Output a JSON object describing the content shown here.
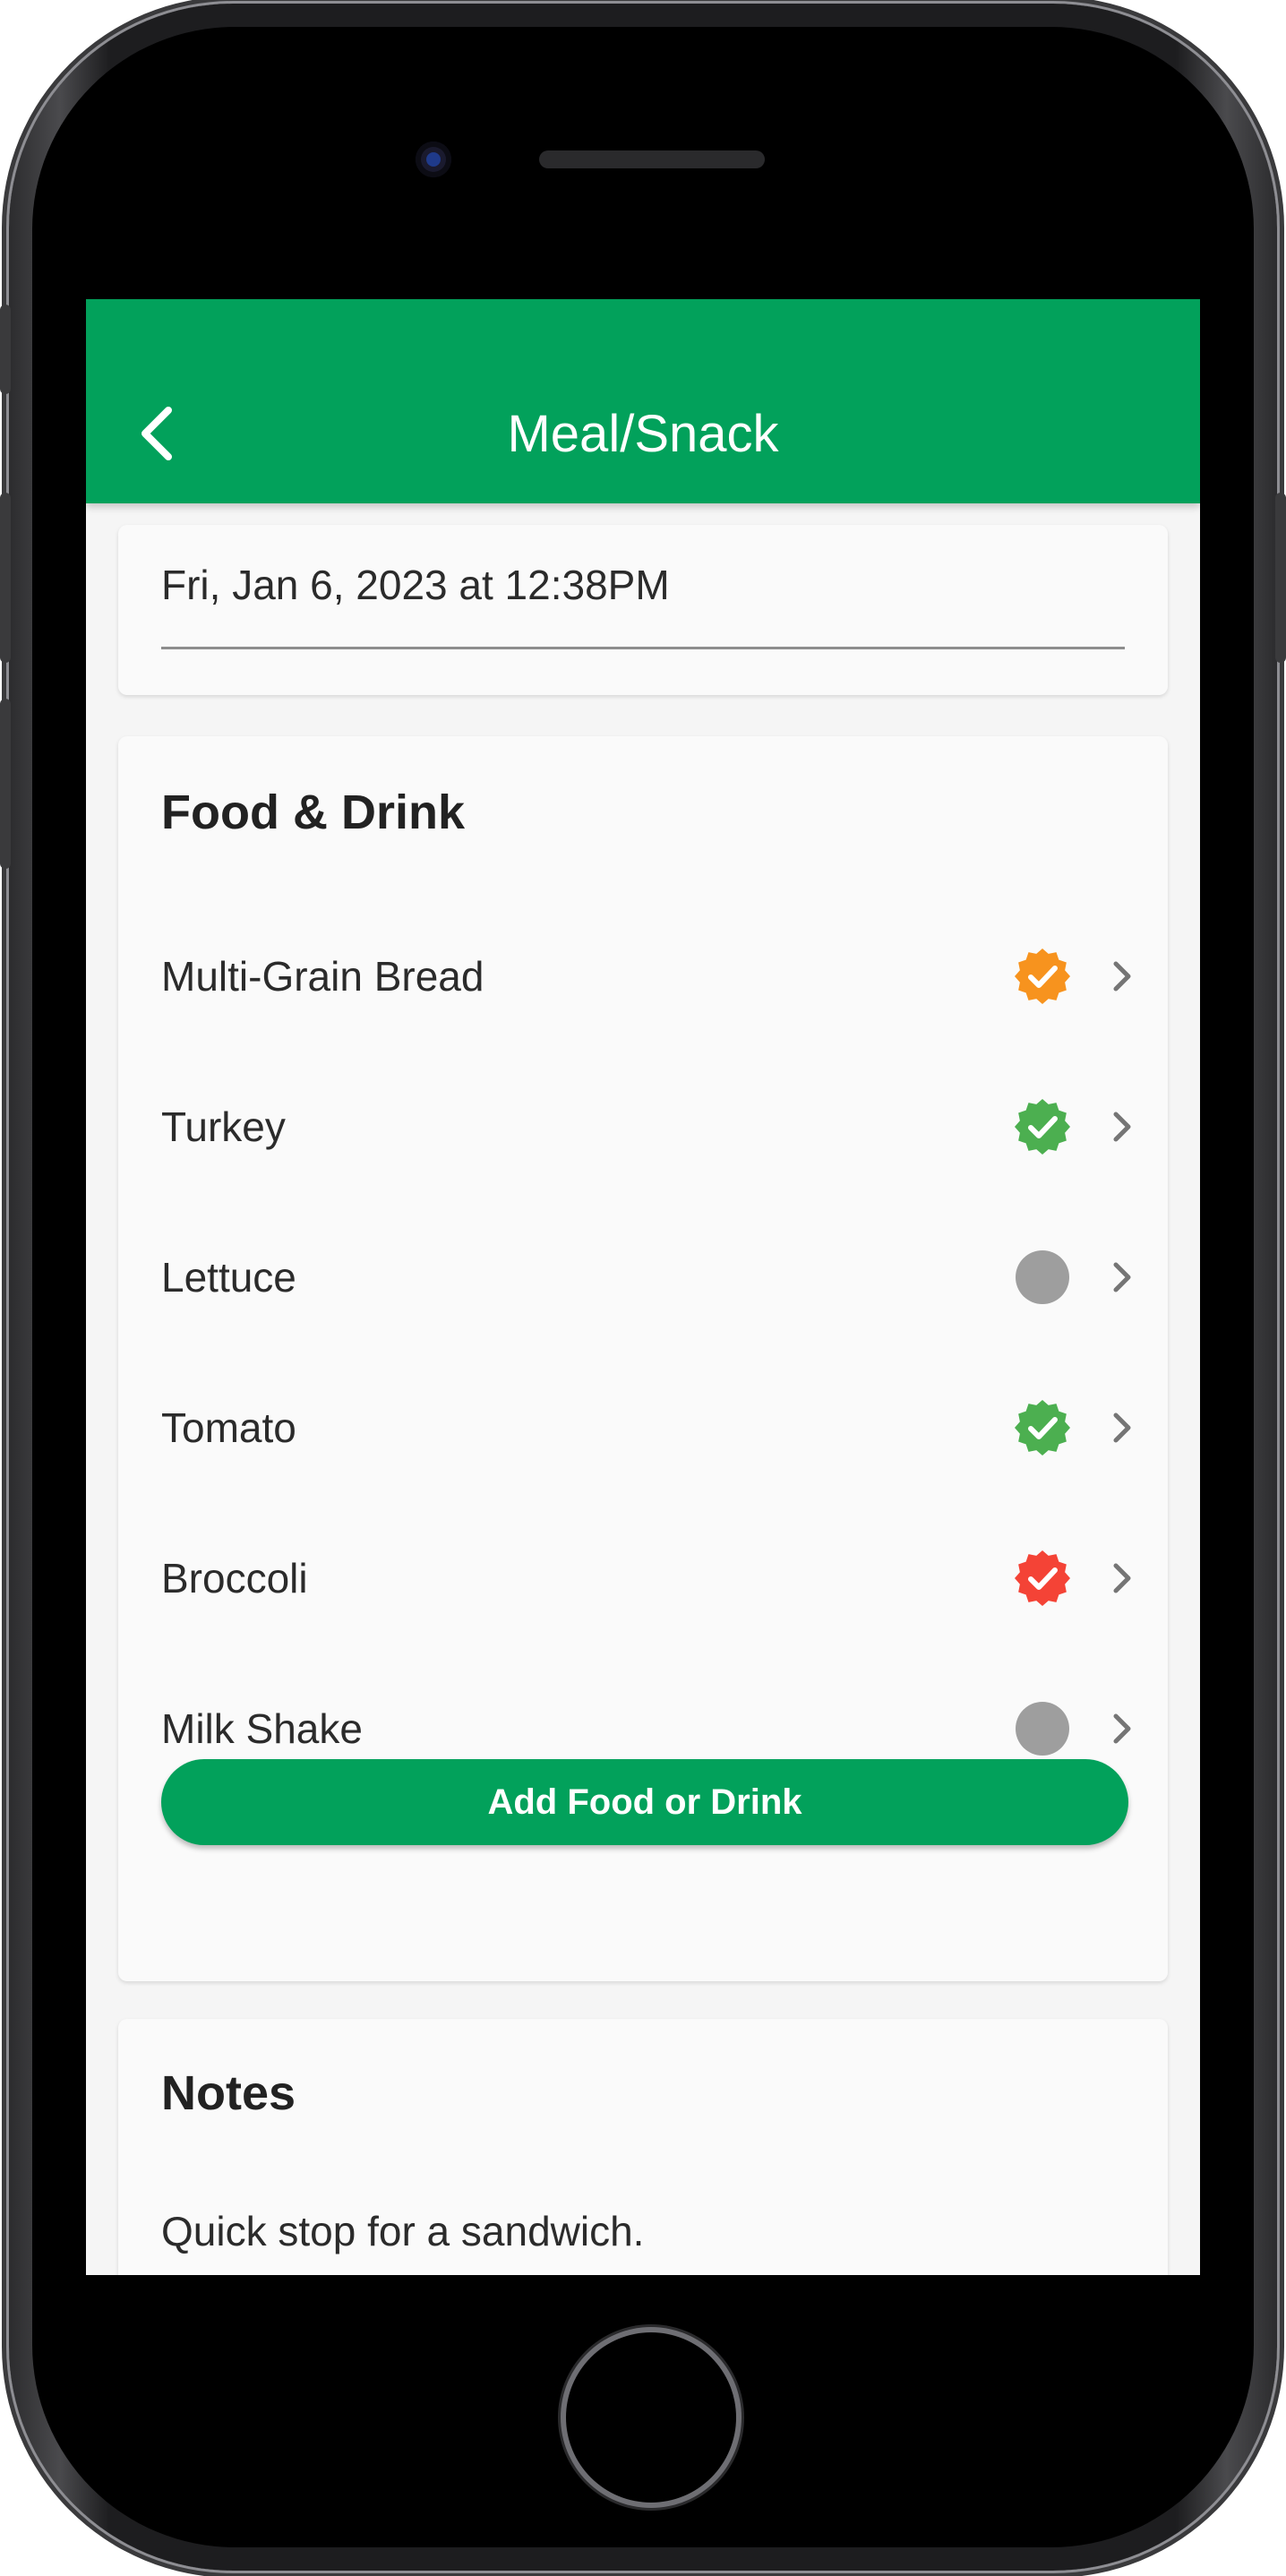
{
  "header": {
    "title": "Meal/Snack",
    "back_icon": "chevron-left-icon"
  },
  "datetime": {
    "value": "Fri, Jan 6, 2023 at 12:38PM"
  },
  "food_section": {
    "title": "Food & Drink",
    "items": [
      {
        "label": "Multi-Grain Bread",
        "status_icon": "verified-badge-icon",
        "status_color": "#f7931e"
      },
      {
        "label": "Turkey",
        "status_icon": "verified-badge-icon",
        "status_color": "#4caf50"
      },
      {
        "label": "Lettuce",
        "status_icon": "empty-circle-icon",
        "status_color": "#9e9e9e"
      },
      {
        "label": "Tomato",
        "status_icon": "verified-badge-icon",
        "status_color": "#4caf50"
      },
      {
        "label": "Broccoli",
        "status_icon": "verified-badge-icon",
        "status_color": "#f44336"
      },
      {
        "label": "Milk Shake",
        "status_icon": "empty-circle-icon",
        "status_color": "#9e9e9e"
      }
    ],
    "add_button_label": "Add Food or Drink"
  },
  "notes_section": {
    "title": "Notes",
    "text": "Quick stop for a sandwich."
  },
  "colors": {
    "brand_green": "#02a15b",
    "background": "#f5f5f5",
    "card": "#fafafa"
  }
}
